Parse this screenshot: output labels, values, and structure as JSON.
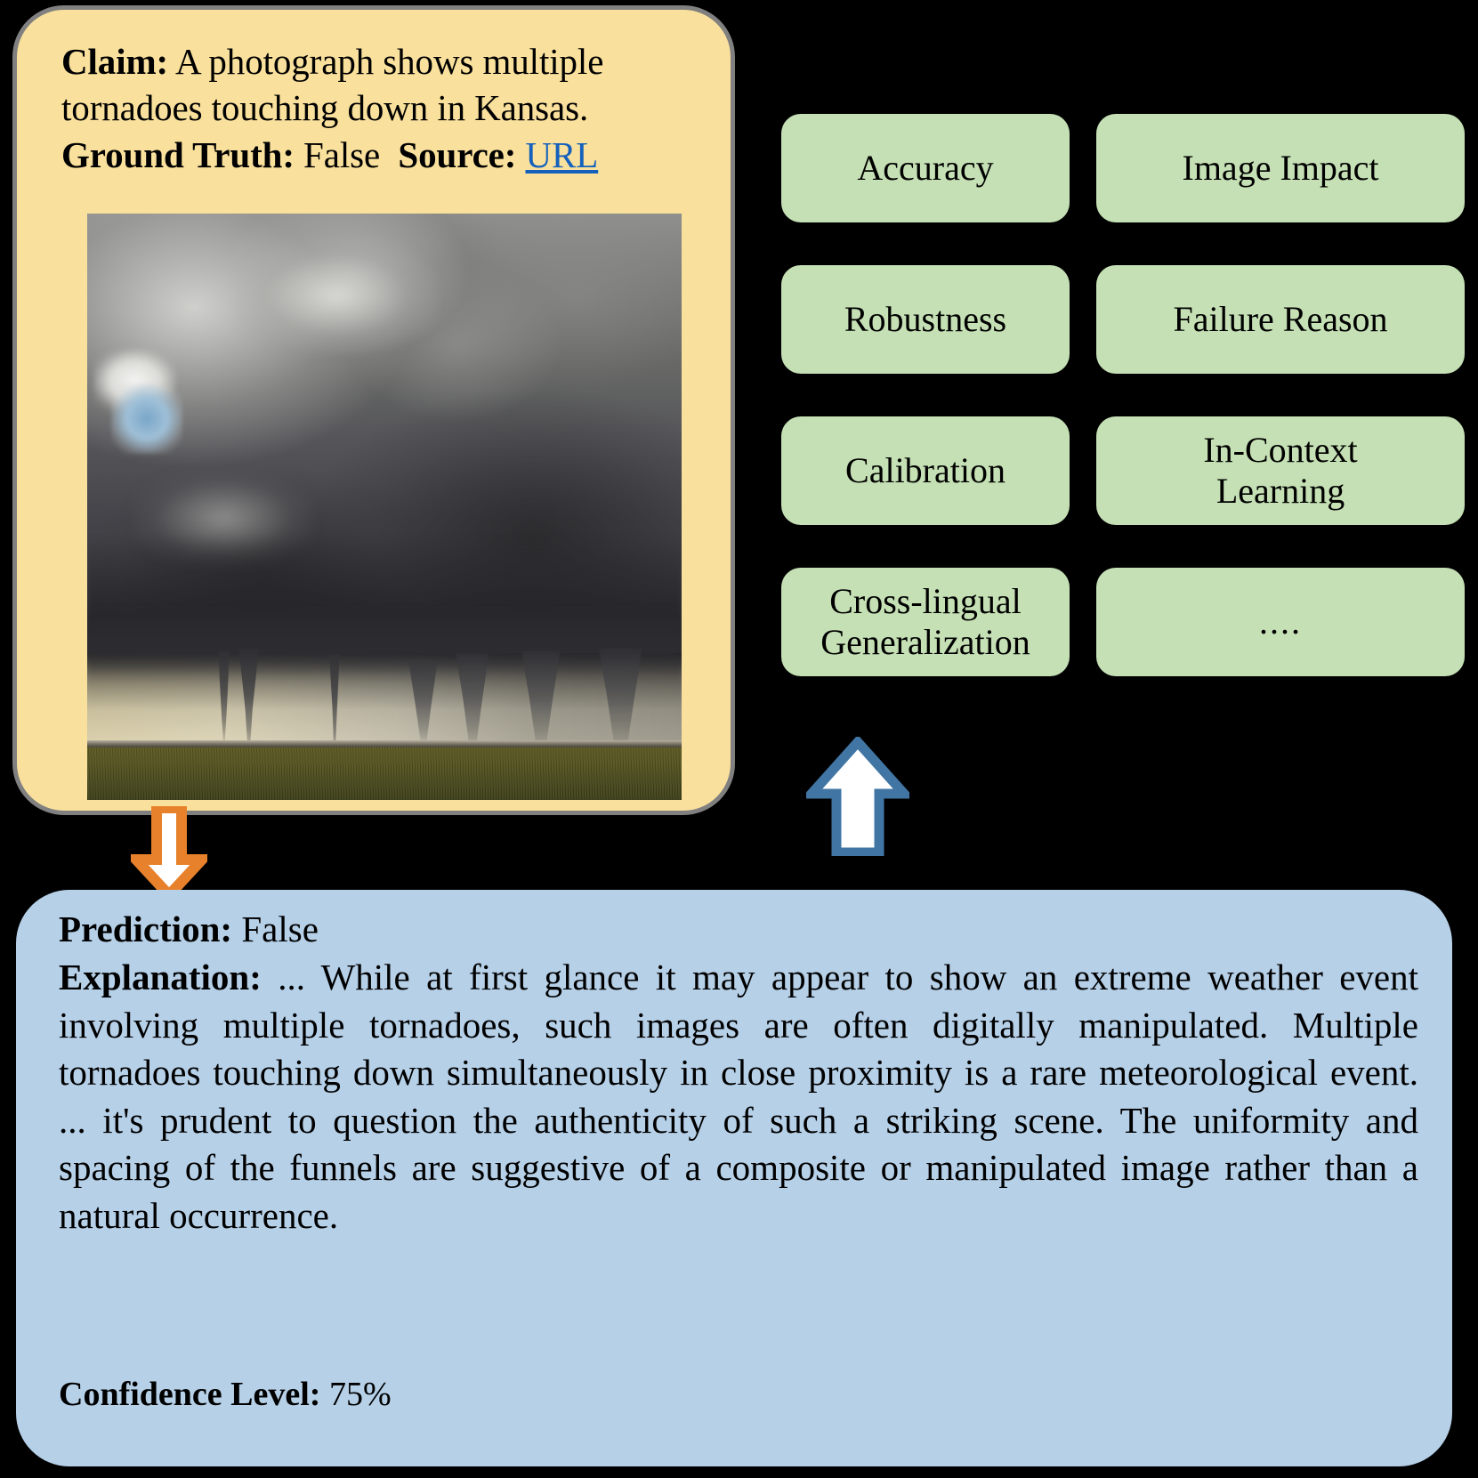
{
  "claim_card": {
    "claim_label": "Claim:",
    "claim_text": " A photograph shows multiple tornadoes touching down in Kansas.",
    "ground_truth_label": "Ground Truth:",
    "ground_truth_value": " False",
    "source_label": "Source:",
    "source_link_text": "URL",
    "image_alt": "photograph of multiple tornado funnels touching down over a green field under dark storm clouds",
    "background_color": "#F9E09C",
    "border_color": "#808080",
    "link_color": "#1560BD"
  },
  "dimensions": {
    "box_color": "#C5E0B4",
    "rows": [
      {
        "left": "Accuracy",
        "right": "Image Impact"
      },
      {
        "left": "Robustness",
        "right": "Failure Reason"
      },
      {
        "left": "Calibration",
        "right": "In-Context\nLearning"
      },
      {
        "left": "Cross-lingual\nGeneralization",
        "right": "...."
      }
    ]
  },
  "arrows": {
    "down_arrow": {
      "name": "orange-down-arrow",
      "fill": "#FFFFFF",
      "stroke": "#E8812B"
    },
    "up_arrow": {
      "name": "blue-up-arrow",
      "fill": "#FFFFFF",
      "stroke": "#4176A4"
    }
  },
  "prediction_card": {
    "background_color": "#B6D0E8",
    "prediction_label": "Prediction:",
    "prediction_value": " False",
    "explanation_label": "Explanation:",
    "explanation_text": " ... While at first glance it may appear to show an extreme weather event involving multiple tornadoes, such images are often digitally manipulated. Multiple tornadoes touching down simultaneously in close proximity is a rare meteorological event. ...  it's prudent to question the authenticity of such a striking scene. The uniformity and spacing of the funnels are suggestive of a composite or manipulated image rather than a natural occurrence.",
    "confidence_label": "Confidence Level:",
    "confidence_value": " 75%"
  }
}
